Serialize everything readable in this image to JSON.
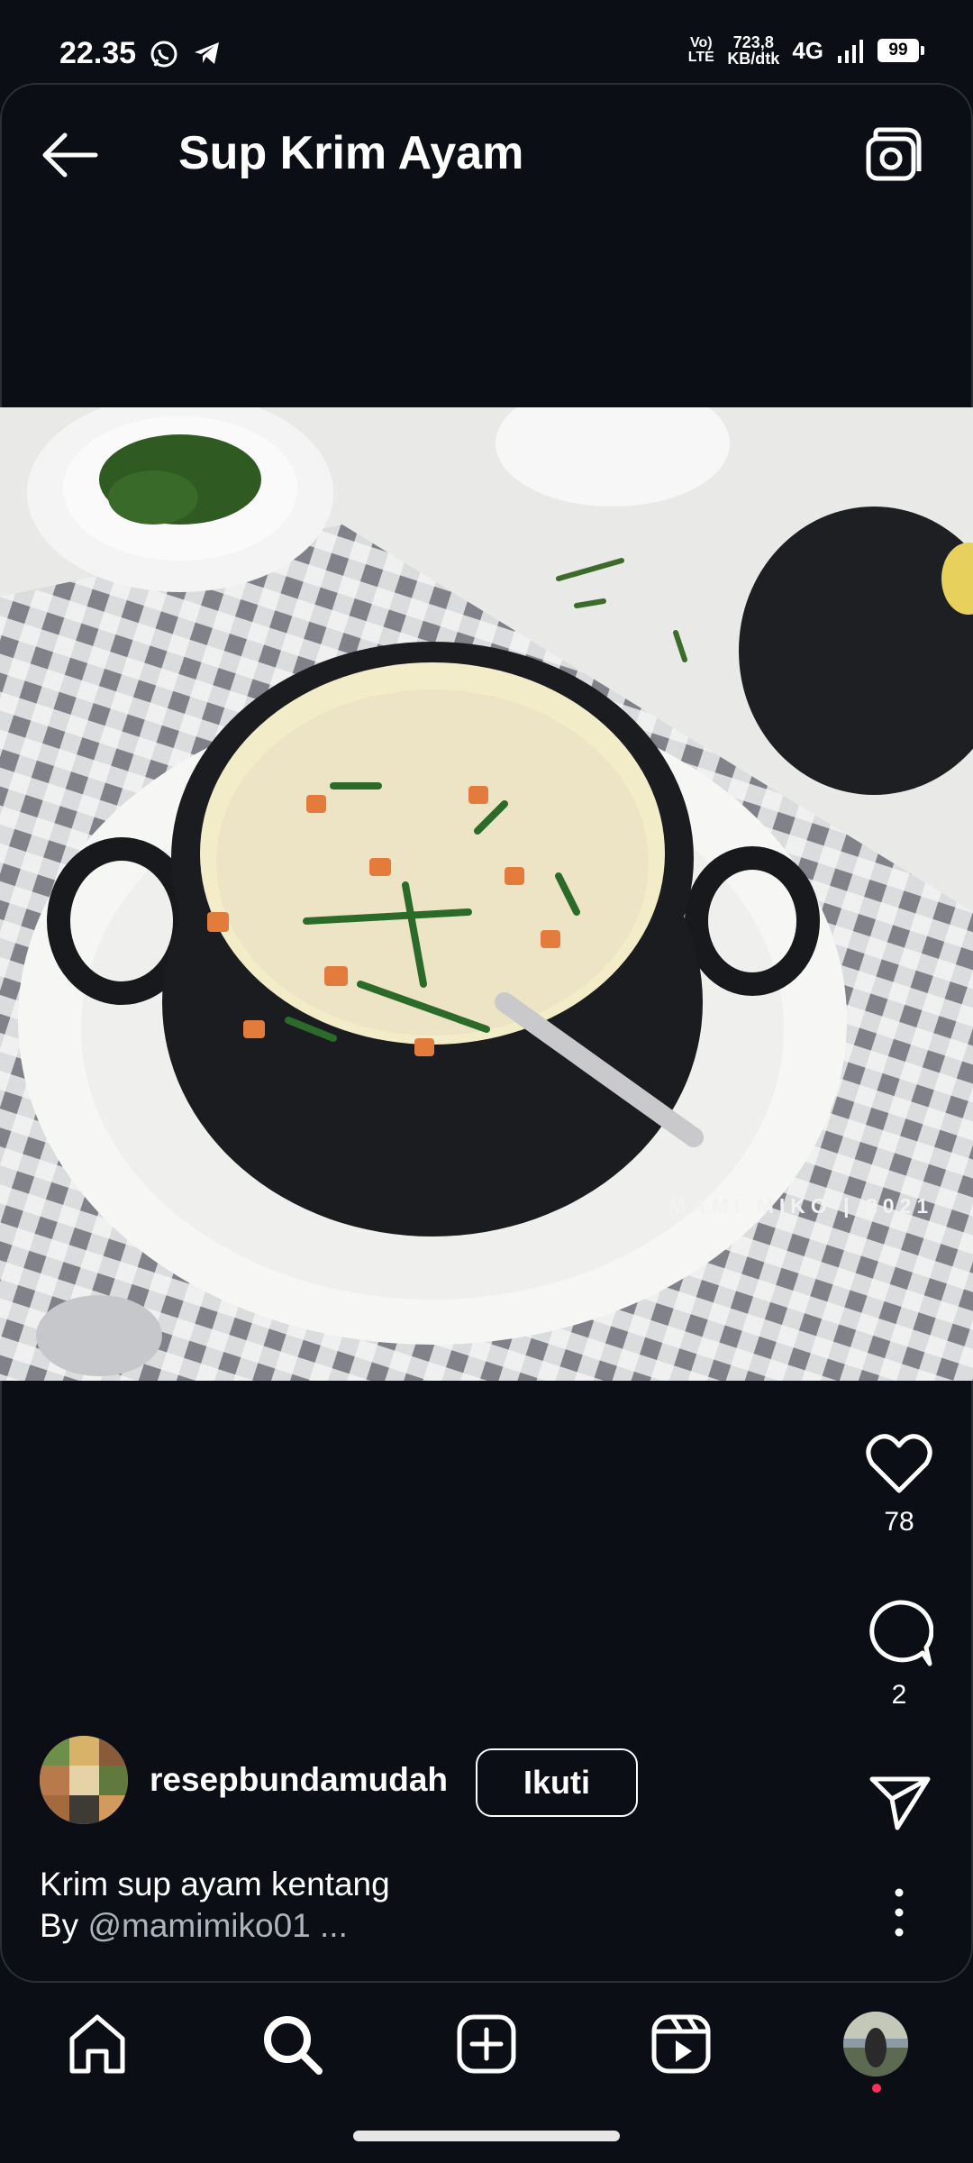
{
  "status_bar": {
    "time": "22.35",
    "volte": "Vo) LTE",
    "speed_value": "723,8",
    "speed_unit": "KB/dtk",
    "network": "4G",
    "battery": "99",
    "icons": [
      "whatsapp-icon",
      "telegram-icon",
      "signal-icon",
      "battery-icon"
    ]
  },
  "header": {
    "title": "Sup Krim Ayam",
    "back_icon": "arrow-left-icon",
    "camera_icon": "camera-icon"
  },
  "post": {
    "watermark": "MAMI MIKO | 2021",
    "likes": "78",
    "comments": "2",
    "author": "resepbundamudah",
    "follow_label": "Ikuti",
    "caption_line1": "Krim sup ayam kentang",
    "caption_by": "By ",
    "caption_handle": "@mamimiko01 ...",
    "actions": [
      "heart-icon",
      "comment-icon",
      "share-icon",
      "more-icon"
    ]
  },
  "bottom_nav": {
    "items": [
      "home-icon",
      "search-icon",
      "create-icon",
      "reels-icon",
      "profile-avatar"
    ],
    "notification_dot_color": "#ff2f55"
  },
  "colors": {
    "background": "#0b0e14",
    "text": "#ffffff",
    "muted": "#aeb3bd"
  }
}
